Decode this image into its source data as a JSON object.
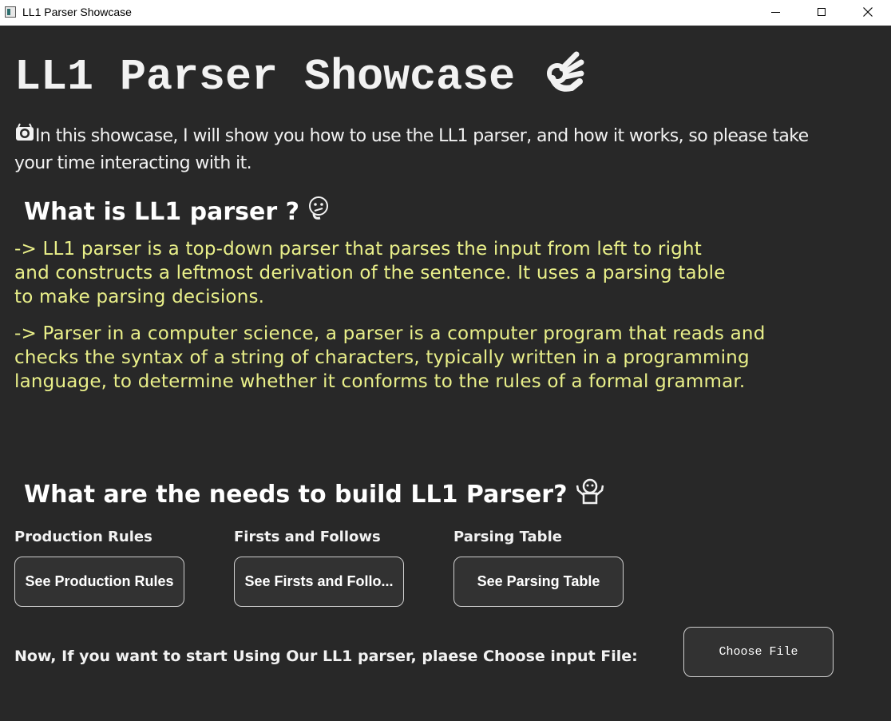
{
  "window": {
    "title": "LL1 Parser Showcase",
    "controls": {
      "minimize": "minimize-icon",
      "maximize": "maximize-icon",
      "close": "close-icon"
    }
  },
  "header": {
    "title": "LL1 Parser Showcase",
    "title_emoji": "ok-hand-icon"
  },
  "intro": {
    "emoji": "camera-face-icon",
    "text": "In this showcase, I will show you how to use the LL1 parser, and how it works, so please take your time interacting with it."
  },
  "what_section": {
    "heading": "What is LL1 parser ?",
    "heading_emoji": "thinking-face-icon",
    "paragraphs": [
      " -> LL1 parser is a top-down parser that parses the input from left to right and constructs a leftmost derivation of the sentence. It uses a parsing table to make parsing decisions.",
      " -> Parser in a computer science, a parser is a computer program that reads and checks the syntax of a string of characters, typically written in a programming language, to determine whether it conforms to the rules of a formal grammar."
    ]
  },
  "needs_section": {
    "heading": "What are the needs to build LL1 Parser?",
    "heading_emoji": "shrug-icon",
    "items": [
      {
        "label": "Production Rules",
        "button": "See Production Rules"
      },
      {
        "label": "Firsts and Follows",
        "button": "See Firsts and Follo..."
      },
      {
        "label": "Parsing Table",
        "button": "See Parsing Table"
      }
    ]
  },
  "start": {
    "text": "Now, If you want to start Using Our LL1 parser, plaese Choose input File:",
    "button": "Choose File"
  },
  "colors": {
    "background": "#282828",
    "titlebar": "#ffffff",
    "accent_text": "#e9ef89",
    "button_bg": "#323232",
    "button_border": "#cfcfcf"
  }
}
